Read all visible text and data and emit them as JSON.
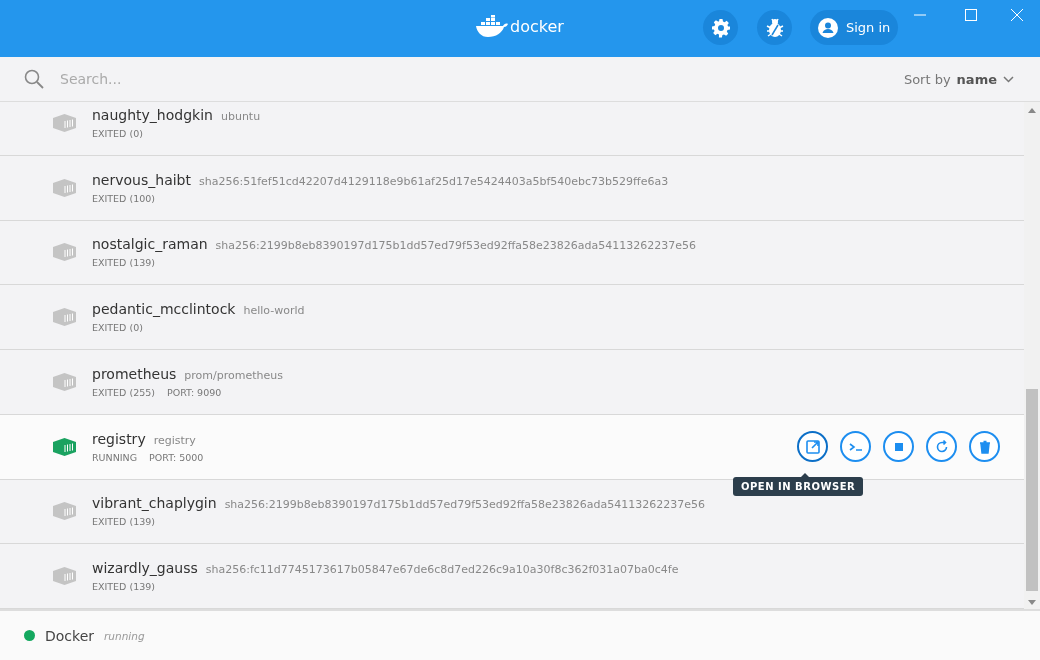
{
  "header": {
    "logo": "docker",
    "sign_in": "Sign in"
  },
  "search": {
    "placeholder": "Search...",
    "sort_prefix": "Sort by",
    "sort_value": "name"
  },
  "containers": [
    {
      "name": "naughty_hodgkin",
      "image": "ubuntu",
      "running": false,
      "status": "EXITED (0)",
      "hovered": false
    },
    {
      "name": "nervous_haibt",
      "image": "sha256:51fef51cd42207d4129118e9b61af25d17e5424403a5bf540ebc73b529ffe6a3",
      "running": false,
      "status": "EXITED (100)",
      "hovered": false
    },
    {
      "name": "nostalgic_raman",
      "image": "sha256:2199b8eb8390197d175b1dd57ed79f53ed92ffa58e23826ada54113262237e56",
      "running": false,
      "status": "EXITED (139)",
      "hovered": false
    },
    {
      "name": "pedantic_mcclintock",
      "image": "hello-world",
      "running": false,
      "status": "EXITED (0)",
      "hovered": false
    },
    {
      "name": "prometheus",
      "image": "prom/prometheus",
      "running": false,
      "status": "EXITED (255)",
      "port": "PORT: 9090",
      "hovered": false
    },
    {
      "name": "registry",
      "image": "registry",
      "running": true,
      "status": "RUNNING",
      "port": "PORT: 5000",
      "hovered": true
    },
    {
      "name": "vibrant_chaplygin",
      "image": "sha256:2199b8eb8390197d175b1dd57ed79f53ed92ffa58e23826ada54113262237e56",
      "running": false,
      "status": "EXITED (139)",
      "hovered": false
    },
    {
      "name": "wizardly_gauss",
      "image": "sha256:fc11d7745173617b05847e67de6c8d7ed226c9a10a30f8c362f031a07ba0c4fe",
      "running": false,
      "status": "EXITED (139)",
      "hovered": false
    }
  ],
  "tooltip": {
    "text": "OPEN IN BROWSER"
  },
  "footer": {
    "name": "Docker",
    "running": true,
    "status": "running",
    "color": "#14a85f"
  }
}
